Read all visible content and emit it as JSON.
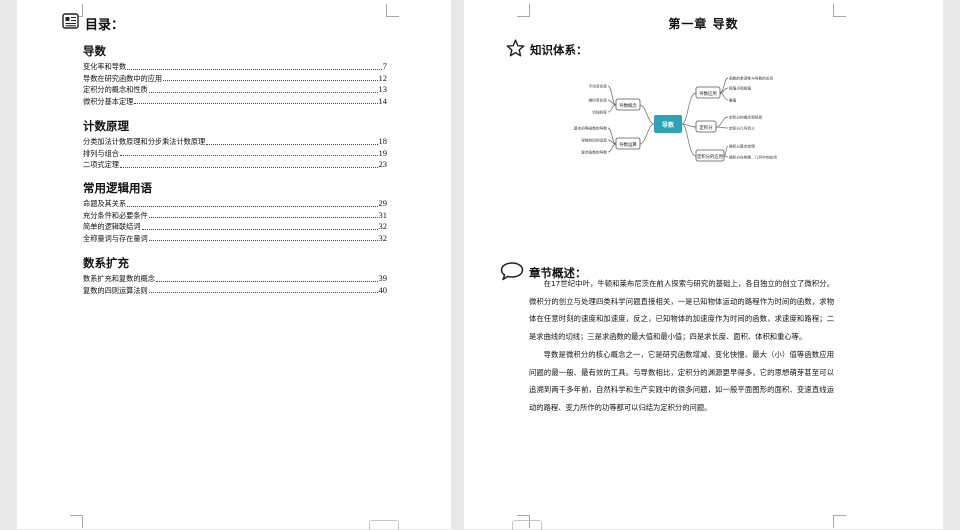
{
  "toc": {
    "title": "目录：",
    "sections": [
      {
        "heading": "导数",
        "entries": [
          {
            "text": "变化率和导数",
            "page": "7"
          },
          {
            "text": "导数在研究函数中的应用",
            "page": "12"
          },
          {
            "text": "定积分的概念和性质",
            "page": "13"
          },
          {
            "text": "微积分基本定理",
            "page": "14"
          }
        ]
      },
      {
        "heading": "计数原理",
        "entries": [
          {
            "text": "分类加法计数原理和分步乘法计数原理",
            "page": "18"
          },
          {
            "text": "排列与组合",
            "page": "19"
          },
          {
            "text": "二项式定理",
            "page": "23"
          }
        ]
      },
      {
        "heading": "常用逻辑用语",
        "entries": [
          {
            "text": "命题及其关系",
            "page": "29"
          },
          {
            "text": "充分条件和必要条件",
            "page": "31"
          },
          {
            "text": "简单的逻辑联结词",
            "page": "32"
          },
          {
            "text": "全称量词与存在量词",
            "page": "32"
          }
        ]
      },
      {
        "heading": "数系扩充",
        "entries": [
          {
            "text": "数系扩充和复数的概念",
            "page": "39"
          },
          {
            "text": "复数的四则运算法则",
            "page": "40"
          }
        ]
      }
    ]
  },
  "chapter": {
    "title": "第一章  导数",
    "knowledge_heading": "知识体系：",
    "overview_heading": "章节概述：",
    "paragraphs": [
      "在17世纪中叶，牛顿和莱布尼茨在前人探索与研究的基础上，各自独立的创立了微积分。微积分的创立与处理四类科学问题直接相关，一是已知物体运动的路程作为时间的函数，求物体在任意时刻的速度和加速度，反之，已知物体的加速度作为时间的函数，求速度和路程；二是求曲线的切线；三是求函数的最大值和最小值；四是求长度、面积、体积和重心等。",
      "导数是微积分的核心概念之一，它是研究函数增减、变化快慢、最大（小）值等函数应用问题的最一般、最有效的工具。与导数相比，定积分的渊源更早得多，它的思想萌芽甚至可以追溯到两千多年前，自然科学和生产实践中的很多问题，如一般平面图形的面积、变速直线运动的路程、变力所作的功等都可以归结为定积分的问题。"
    ]
  },
  "mindmap": {
    "center": "导数",
    "left": [
      {
        "label": "导数概念",
        "children": [
          "平均变化率",
          "瞬时变化率",
          "切线斜率"
        ]
      },
      {
        "label": "导数运算",
        "children": [
          "基本初等函数的导数",
          "导数的四则运算",
          "复合函数的导数"
        ]
      }
    ],
    "right": [
      {
        "label": "导数应用",
        "children": [
          "函数的单调性与导数的关系",
          "极值点和极值",
          "最值"
        ]
      },
      {
        "label": "定积分",
        "children": [
          "定积分的概念和性质",
          "定积分几何意义"
        ]
      },
      {
        "label": "定积分的应用",
        "children": [
          "微积分基本定理",
          "微积分在物理、几何中的应用"
        ]
      }
    ]
  },
  "colors": {
    "center": "#2fa3b5",
    "branch_border": "#555555",
    "line": "#666666"
  },
  "icons": {
    "toc": "book-icon",
    "knowledge": "star-icon",
    "overview": "speech-bubble-icon"
  }
}
